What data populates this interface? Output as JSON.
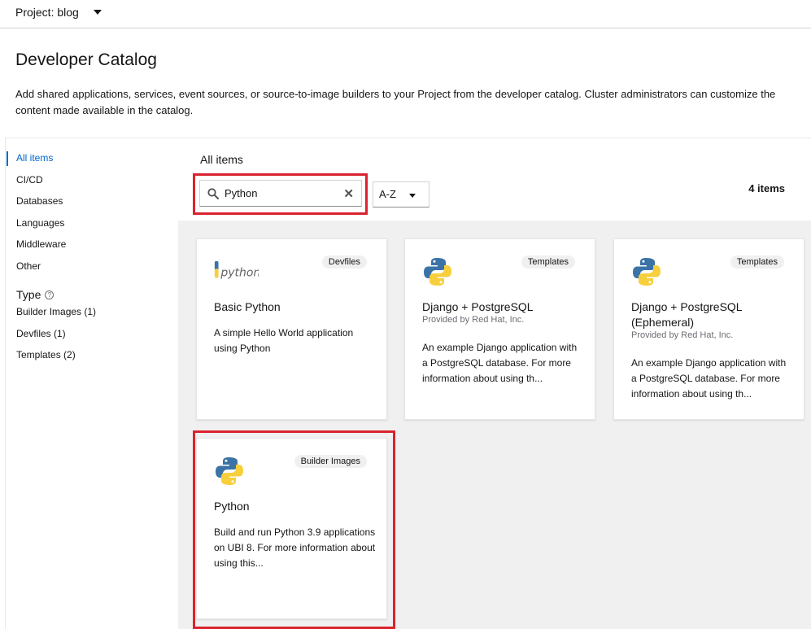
{
  "topbar": {
    "project_label": "Project: blog"
  },
  "page": {
    "title": "Developer Catalog",
    "description": "Add shared applications, services, event sources, or source-to-image builders to your Project from the developer catalog. Cluster administrators can customize the content made available in the catalog."
  },
  "sidebar": {
    "categories": [
      "All items",
      "CI/CD",
      "Databases",
      "Languages",
      "Middleware",
      "Other"
    ],
    "active_category": "All items",
    "type_heading": "Type",
    "type_filters": [
      "Builder Images (1)",
      "Devfiles (1)",
      "Templates (2)"
    ]
  },
  "main": {
    "heading": "All items",
    "search": {
      "value": "Python",
      "clear_glyph": "✕"
    },
    "sort": {
      "selected": "A-Z"
    },
    "item_count": "4 items"
  },
  "cards": [
    {
      "icon": "python-wordmark-icon",
      "badge": "Devfiles",
      "title": "Basic Python",
      "provider": "",
      "description": "A simple Hello World application using Python"
    },
    {
      "icon": "python-logo-icon",
      "badge": "Templates",
      "title": "Django + PostgreSQL",
      "provider": "Provided by Red Hat, Inc.",
      "description": "An example Django application with a PostgreSQL database. For more information about using th..."
    },
    {
      "icon": "python-logo-icon",
      "badge": "Templates",
      "title": "Django + PostgreSQL (Ephemeral)",
      "provider": "Provided by Red Hat, Inc.",
      "description": "An example Django application with a PostgreSQL database. For more information about using th..."
    },
    {
      "icon": "python-logo-icon",
      "badge": "Builder Images",
      "title": "Python",
      "provider": "",
      "description": "Build and run Python 3.9 applications on UBI 8. For more information about using this..."
    }
  ],
  "colors": {
    "link": "#0066cc",
    "highlight": "#d9232e",
    "python_blue": "#3b73a6",
    "python_yellow": "#f7cf3c"
  }
}
